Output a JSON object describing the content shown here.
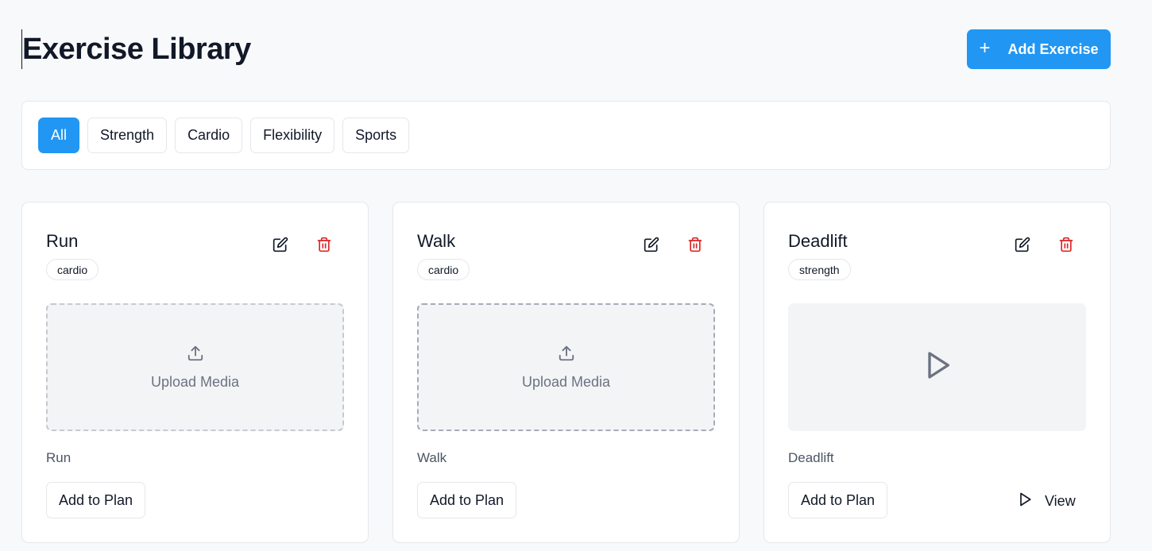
{
  "header": {
    "title": "Exercise Library",
    "add_button": {
      "icon": "plus-icon",
      "label": "Add Exercise"
    }
  },
  "filters": [
    {
      "label": "All",
      "active": true
    },
    {
      "label": "Strength",
      "active": false
    },
    {
      "label": "Cardio",
      "active": false
    },
    {
      "label": "Flexibility",
      "active": false
    },
    {
      "label": "Sports",
      "active": false
    }
  ],
  "cards": [
    {
      "name": "Run",
      "tag": "cardio",
      "media": {
        "type": "upload",
        "label": "Upload Media"
      },
      "description": "Run",
      "add_to_plan": "Add to Plan"
    },
    {
      "name": "Walk",
      "tag": "cardio",
      "media": {
        "type": "upload",
        "label": "Upload Media"
      },
      "description": "Walk",
      "add_to_plan": "Add to Plan"
    },
    {
      "name": "Deadlift",
      "tag": "strength",
      "media": {
        "type": "video"
      },
      "description": "Deadlift",
      "add_to_plan": "Add to Plan",
      "view": "View"
    }
  ],
  "colors": {
    "accent": "#2196f3",
    "delete": "#dc2626",
    "muted_text": "#6b7280",
    "page_bg": "#f8f9fb"
  }
}
